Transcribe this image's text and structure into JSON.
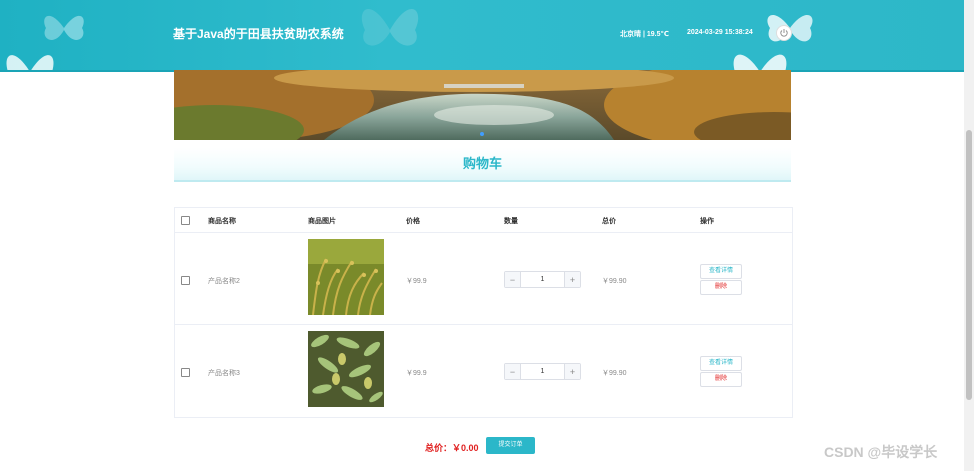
{
  "header": {
    "title": "基于Java的于田县扶贫助农系统",
    "weather": "北京晴 | 19.5℃",
    "datetime": "2024-03-29   15:38:24"
  },
  "section_title": "购物车",
  "table": {
    "columns": [
      "商品名称",
      "商品图片",
      "价格",
      "数量",
      "总价",
      "操作"
    ],
    "rows": [
      {
        "name": "产品名称2",
        "price": "￥99.9",
        "quantity": "1",
        "total": "￥99.90",
        "detail_label": "查看详情",
        "delete_label": "删除",
        "image": "rice-field"
      },
      {
        "name": "产品名称3",
        "price": "￥99.9",
        "quantity": "1",
        "total": "￥99.90",
        "detail_label": "查看详情",
        "delete_label": "删除",
        "image": "mango-tree"
      }
    ]
  },
  "footer": {
    "total_label": "总价：￥0.00",
    "submit_label": "提交订单"
  },
  "watermark": "CSDN @毕设学长",
  "colors": {
    "header": "#2db7c8",
    "accent": "#2bb7c9",
    "danger": "#e02020"
  }
}
